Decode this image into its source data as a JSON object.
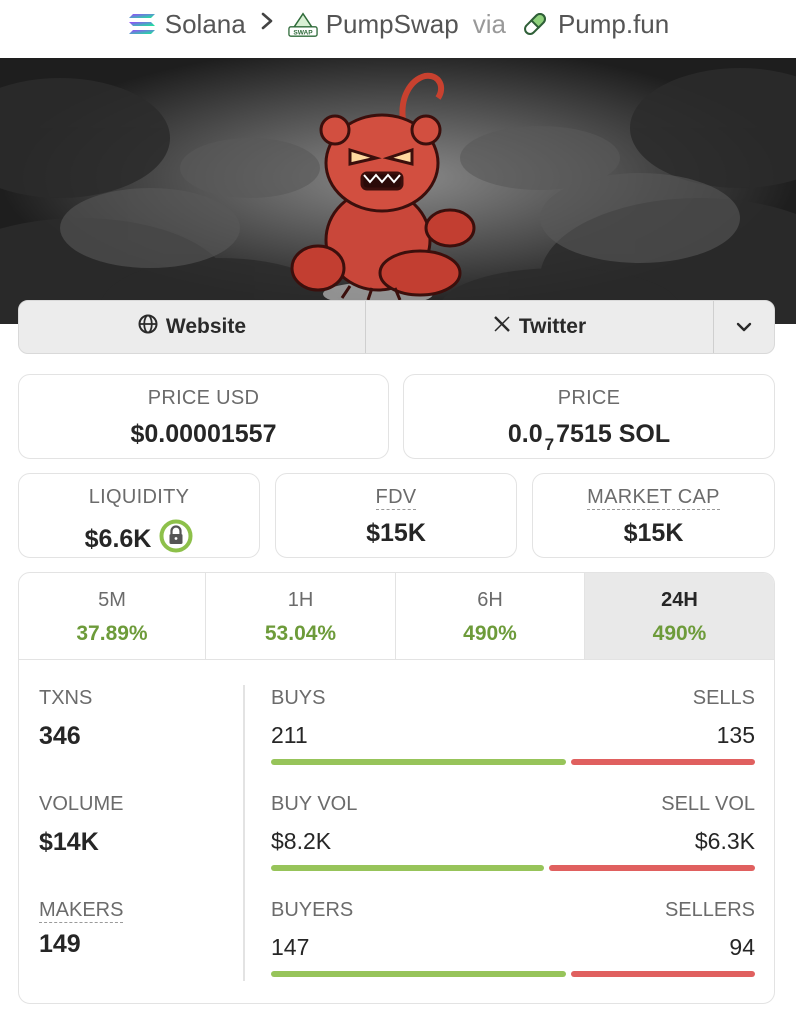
{
  "breadcrumb": {
    "chain": "Solana",
    "dex": "PumpSwap",
    "via": "via",
    "launchpad": "Pump.fun",
    "dex_badge": "SWAP"
  },
  "links": {
    "website": "Website",
    "twitter": "Twitter"
  },
  "price_usd": {
    "label": "PRICE USD",
    "value": "$0.00001557"
  },
  "price_native": {
    "label": "PRICE",
    "prefix": "0.0",
    "zeros": "7",
    "rest": "7515 SOL"
  },
  "liquidity": {
    "label": "LIQUIDITY",
    "value": "$6.6K"
  },
  "fdv": {
    "label": "FDV",
    "value": "$15K"
  },
  "market_cap": {
    "label": "MARKET CAP",
    "value": "$15K"
  },
  "tabs": [
    {
      "label": "5M",
      "value": "37.89%"
    },
    {
      "label": "1H",
      "value": "53.04%"
    },
    {
      "label": "6H",
      "value": "490%"
    },
    {
      "label": "24H",
      "value": "490%",
      "active": true
    }
  ],
  "stats": {
    "txns": {
      "label": "TXNS",
      "value": "346"
    },
    "volume": {
      "label": "VOLUME",
      "value": "$14K"
    },
    "makers": {
      "label": "MAKERS",
      "value": "149"
    },
    "buys": {
      "left_label": "BUYS",
      "right_label": "SELLS",
      "left_value": "211",
      "right_value": "135",
      "left_share": 0.61
    },
    "vol": {
      "left_label": "BUY VOL",
      "right_label": "SELL VOL",
      "left_value": "$8.2K",
      "right_value": "$6.3K",
      "left_share": 0.565
    },
    "traders": {
      "left_label": "BUYERS",
      "right_label": "SELLERS",
      "left_value": "147",
      "right_value": "94",
      "left_share": 0.61
    }
  },
  "colors": {
    "positive": "#6d9b3a",
    "buy_bar": "#97c45a",
    "sell_bar": "#e0605f",
    "lock_ring": "#8dc04a"
  },
  "icons": [
    "solana-logo-icon",
    "chevron-right-icon",
    "pumpswap-logo-icon",
    "pill-icon",
    "globe-icon",
    "x-logo-icon",
    "chevron-down-icon",
    "lock-icon"
  ]
}
